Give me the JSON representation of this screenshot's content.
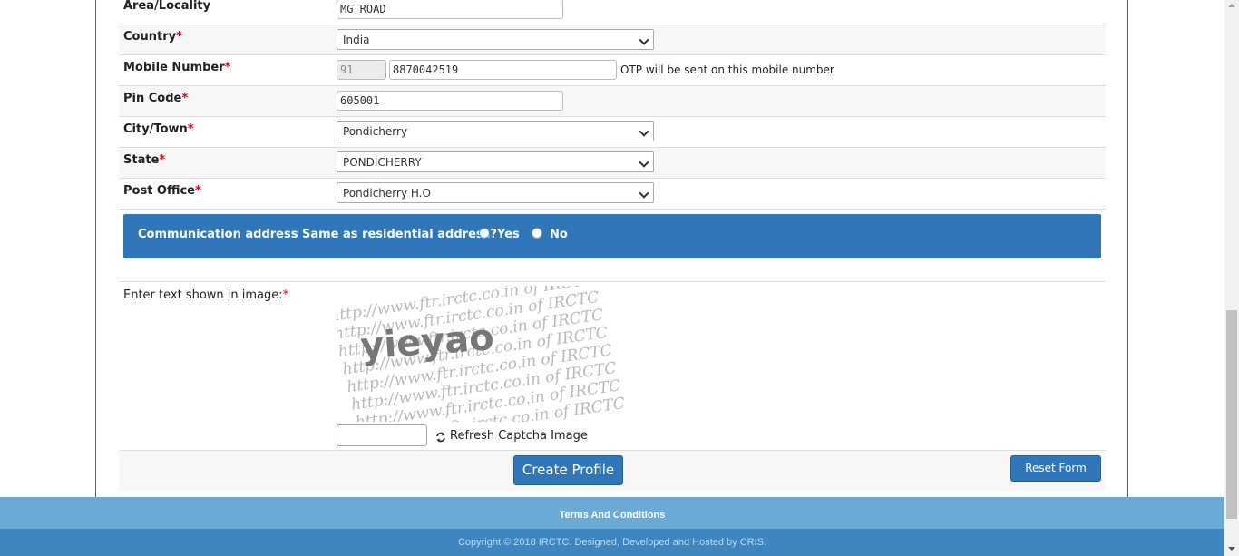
{
  "fields": {
    "area": {
      "label": "Area/Locality",
      "value": "MG ROAD"
    },
    "country": {
      "label": "Country",
      "required_mark": "*",
      "value": "India"
    },
    "mobile": {
      "label": "Mobile Number",
      "required_mark": "*",
      "country_code": "91",
      "value": "8870042519",
      "note": "OTP will be sent on this mobile number"
    },
    "pin": {
      "label": "Pin Code",
      "required_mark": "*",
      "value": "605001"
    },
    "city": {
      "label": "City/Town",
      "required_mark": "*",
      "value": "Pondicherry"
    },
    "state": {
      "label": "State",
      "required_mark": "*",
      "value": "PONDICHERRY"
    },
    "post_office": {
      "label": "Post Office",
      "required_mark": "*",
      "value": "Pondicherry H.O"
    }
  },
  "communication": {
    "question": "Communication address Same as residential address?",
    "yes_label": "Yes",
    "no_label": "No",
    "selected": "Yes"
  },
  "captcha": {
    "label": "Enter text shown in image:",
    "required_mark": "*",
    "image_text": "yieyao",
    "watermark_text": "http://www.ftr.irctc.co.in of IRCTC",
    "refresh_label": "Refresh Captcha Image",
    "input_value": ""
  },
  "actions": {
    "create_label": "Create Profile",
    "reset_label": "Reset Form"
  },
  "footer": {
    "terms": "Terms And Conditions",
    "copyright": "Copyright © 2018 IRCTC. Designed, Developed and Hosted by CRIS."
  },
  "colors": {
    "primary": "#2f77b8",
    "footer_light": "#6aaad6",
    "footer_dark": "#3e86bf",
    "required": "#d9001b"
  },
  "icons": {
    "refresh": "refresh-icon",
    "dropdown": "chevron-down-icon"
  }
}
